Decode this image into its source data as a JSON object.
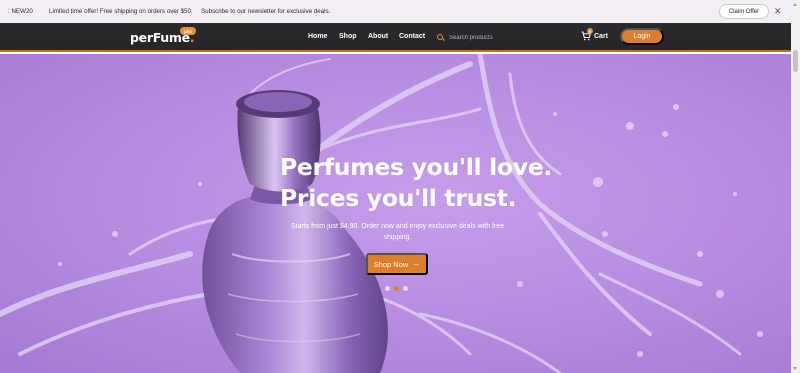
{
  "announcement": {
    "code": ": NEW20",
    "offer": "Limited time offer! Free shipping on orders over $50.",
    "newsletter": "Subscribe to our newsletter for exclusive deals.",
    "claim_label": "Claim Offer",
    "close_icon": "close-icon"
  },
  "nav": {
    "logo_main": "perFume",
    "logo_dot": ".",
    "logo_badge": "pks",
    "links": [
      "Home",
      "Shop",
      "About",
      "Contact"
    ],
    "search_placeholder": "Search products",
    "cart_label": "Cart",
    "cart_count": "0",
    "login_label": "Login"
  },
  "hero": {
    "title_line1": "Perfumes you'll love.",
    "title_line2": "Prices you'll trust.",
    "subtitle": "Starts from just $4.90. Order now and enjoy exclusive deals with free shipping.",
    "cta_label": "Shop Now",
    "cta_icon": "arrow-right-icon",
    "slides_total": 3,
    "slide_active": 2
  },
  "colors": {
    "accent": "#dc7e2a",
    "nav_bg": "#2b2a2d",
    "hero_bg": "#b58ae0",
    "announce_bg": "#f3eef6"
  }
}
